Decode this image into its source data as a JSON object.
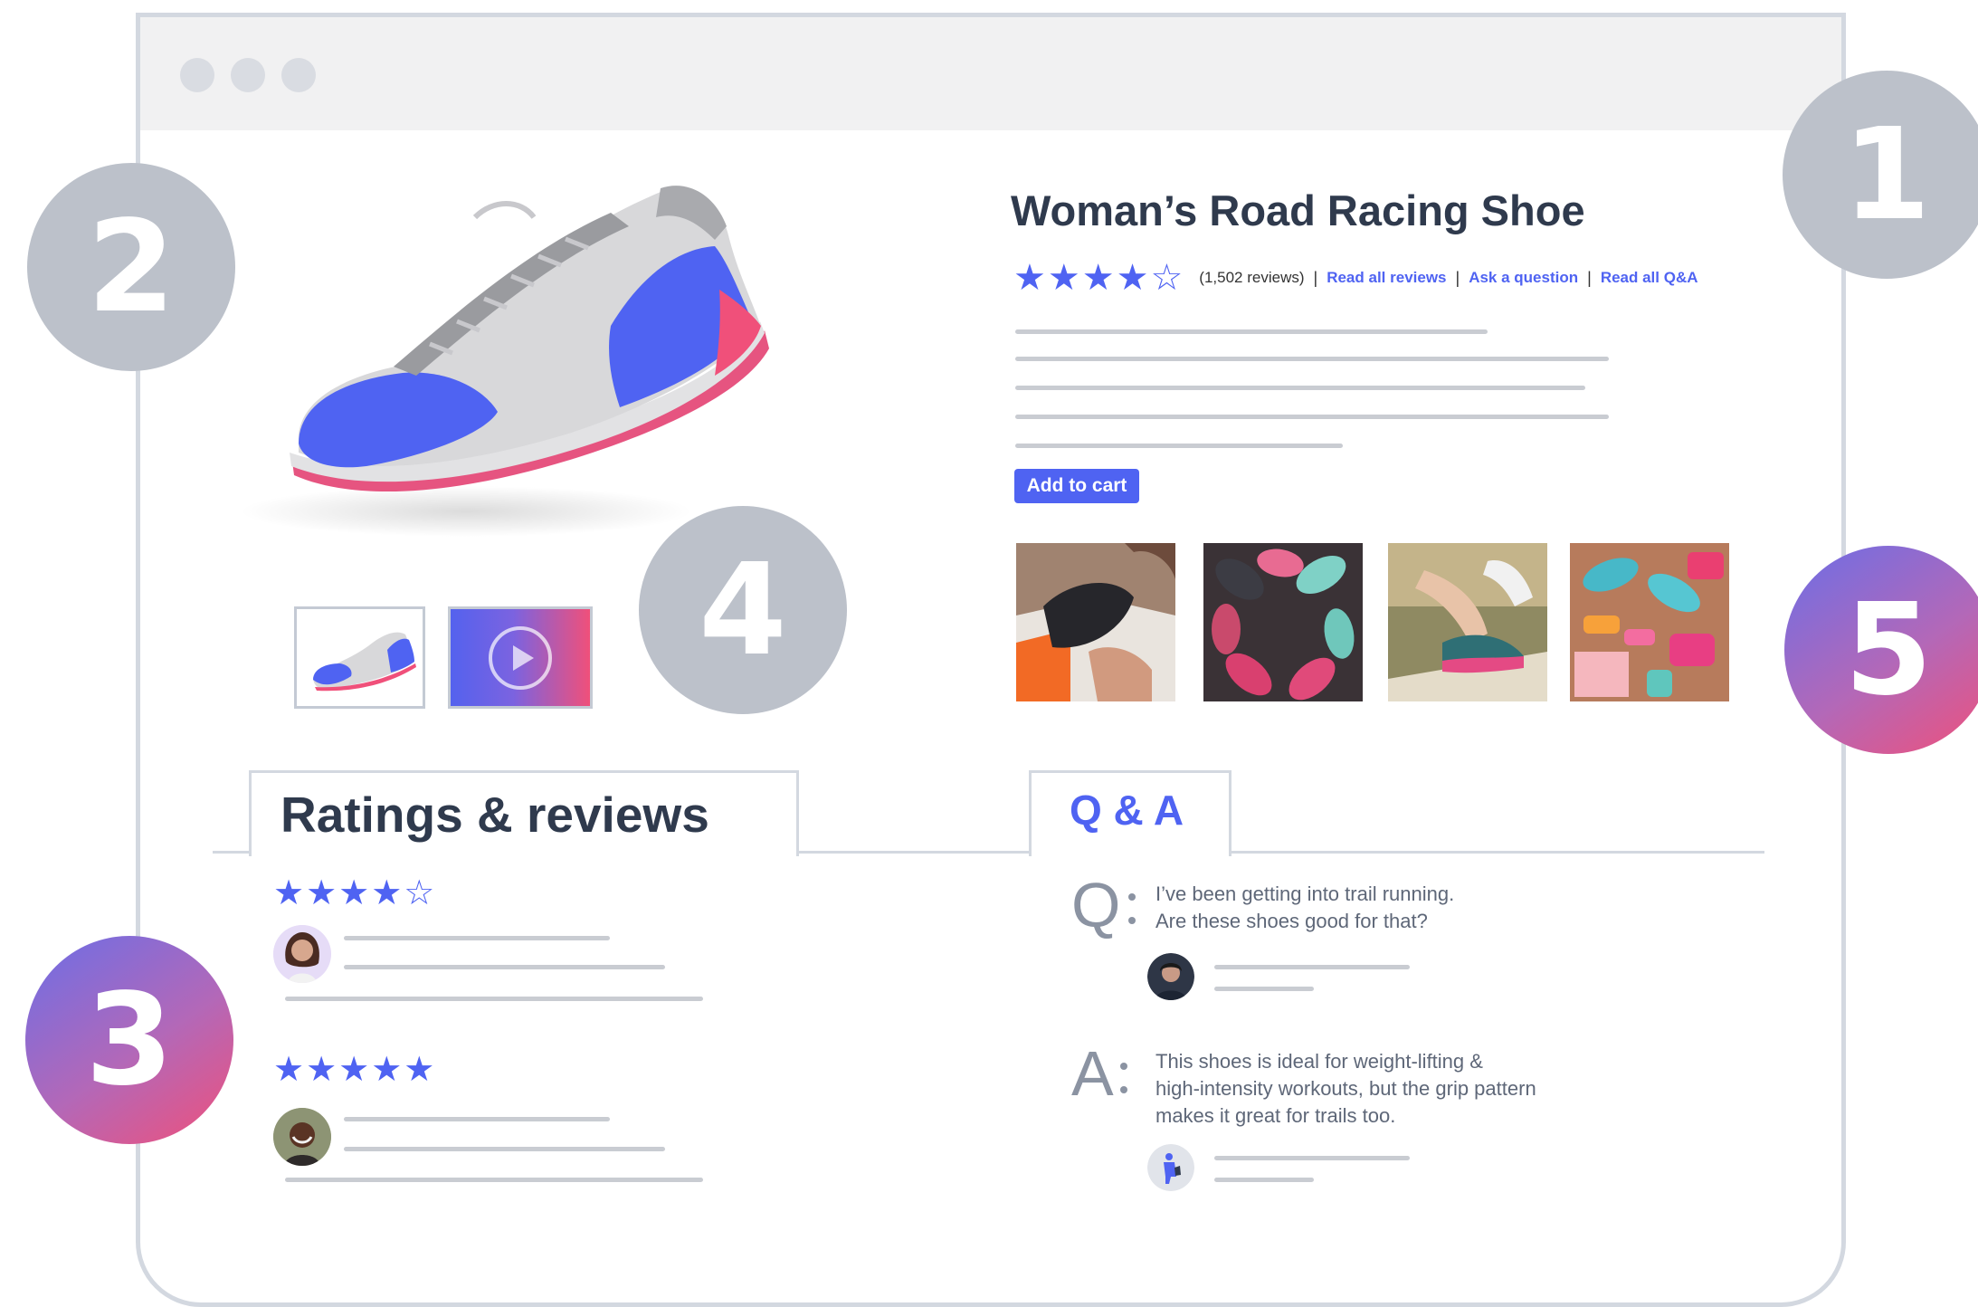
{
  "badges": [
    "1",
    "2",
    "3",
    "4",
    "5"
  ],
  "product": {
    "title": "Woman’s Road Racing Shoe",
    "rating_stars": "★★★★☆",
    "review_count": "(1,502 reviews)",
    "separator": "|",
    "links": [
      "Read all reviews",
      "Ask a question",
      "Read all Q&A"
    ],
    "add_to_cart": "Add to cart"
  },
  "gallery": {
    "thumbnails": [
      "shoe-thumbnail",
      "video-thumbnail"
    ],
    "customer_photos": [
      "shoe-box-photo",
      "shoes-circle-photo",
      "tying-laces-photo",
      "gym-gear-photo"
    ]
  },
  "tabs": {
    "reviews": "Ratings & reviews",
    "qa": "Q & A"
  },
  "reviews": [
    {
      "stars": "★★★★☆"
    },
    {
      "stars": "★★★★★"
    }
  ],
  "qa": {
    "q_letter": "Q",
    "question_lines": [
      "I’ve been getting into trail running.",
      "Are these shoes good for that?"
    ],
    "a_letter": "A",
    "answer_lines": [
      "This shoes is ideal for weight-lifting &",
      "high-intensity workouts, but the grip pattern",
      "makes it great for trails too."
    ]
  },
  "colors": {
    "accent": "#4f63f2",
    "badge_gray": "#bcc1ca",
    "gradient_start": "#6c6ee6",
    "gradient_end": "#f0507a"
  }
}
